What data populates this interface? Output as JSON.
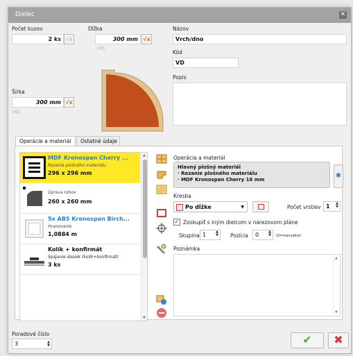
{
  "window": {
    "title": "Dielec",
    "close_glyph": "✕"
  },
  "dims": {
    "pocet_kusov": {
      "label": "Počet kusov",
      "value": "2 ks"
    },
    "dlzka": {
      "label": "Dĺžka",
      "value": "300 mm",
      "code": "[XZ]"
    },
    "sirka": {
      "label": "Šírka",
      "value": "300 mm",
      "code": "[XZ]"
    },
    "sqrt_glyph": "√x"
  },
  "props": {
    "nazov": {
      "label": "Názov",
      "value": "Vrch/dno"
    },
    "kod": {
      "label": "Kód",
      "value": "VD"
    },
    "popis": {
      "label": "Popis",
      "value": ""
    }
  },
  "tabs": [
    {
      "label": "Operácie a materiál",
      "active": true
    },
    {
      "label": "Ostatné údaje",
      "active": false
    }
  ],
  "operations": [
    {
      "title": "MDF Kronospan Cherry ...",
      "subtitle": "Rezanie plošného materiálu",
      "value": "296 x 296 mm",
      "icon": "panel-cut-icon",
      "selected": true
    },
    {
      "title": "",
      "subtitle": "Úprava rohov",
      "value": "260 x 260 mm",
      "icon": "corner-edit-icon",
      "selected": false
    },
    {
      "title": "5x ABS Kronospan Birch...",
      "subtitle": "Hranovanie",
      "value": "1,0884 m",
      "icon": "edge-banding-icon",
      "selected": false
    },
    {
      "title": "Kolík + konfirmát",
      "subtitle": "Spájanie dosiek (kolík+konfirmát)",
      "value": "3 ks",
      "icon": "dowel-connector-icon",
      "selected": false
    }
  ],
  "operation_detail": {
    "label": "Operácia a materiál",
    "lines": [
      "Hlavný plošný materiál",
      " · Rezanie plošného materiálu",
      " · MDF Kronospan Cherry 16 mm"
    ],
    "kresba_label": "Kresba",
    "kresba_value": "Po dĺžke",
    "pocet_vrstiev_label": "Počet vrstiev",
    "pocet_vrstiev_value": "1",
    "zoskupit_label": "Zoskupiť s iným dielcom v nárezovom pláne",
    "skupina_label": "Skupina",
    "skupina_value": "1",
    "pozicia_label": "Pozícia",
    "pozicia_value": "0",
    "pozicia_note": "(0=manuálne)",
    "poznamka_label": "Poznámka"
  },
  "poradove": {
    "label": "Poradové číslo",
    "value": "3"
  },
  "buttons": {
    "ok_glyph": "✔",
    "cancel_glyph": "✖"
  },
  "colors": {
    "accent_yellow": "#ffe927",
    "wood": "#c14f1e",
    "ok_green": "#5aaa2e",
    "cancel_red": "#d33a3a",
    "blue": "#2a80c8"
  }
}
